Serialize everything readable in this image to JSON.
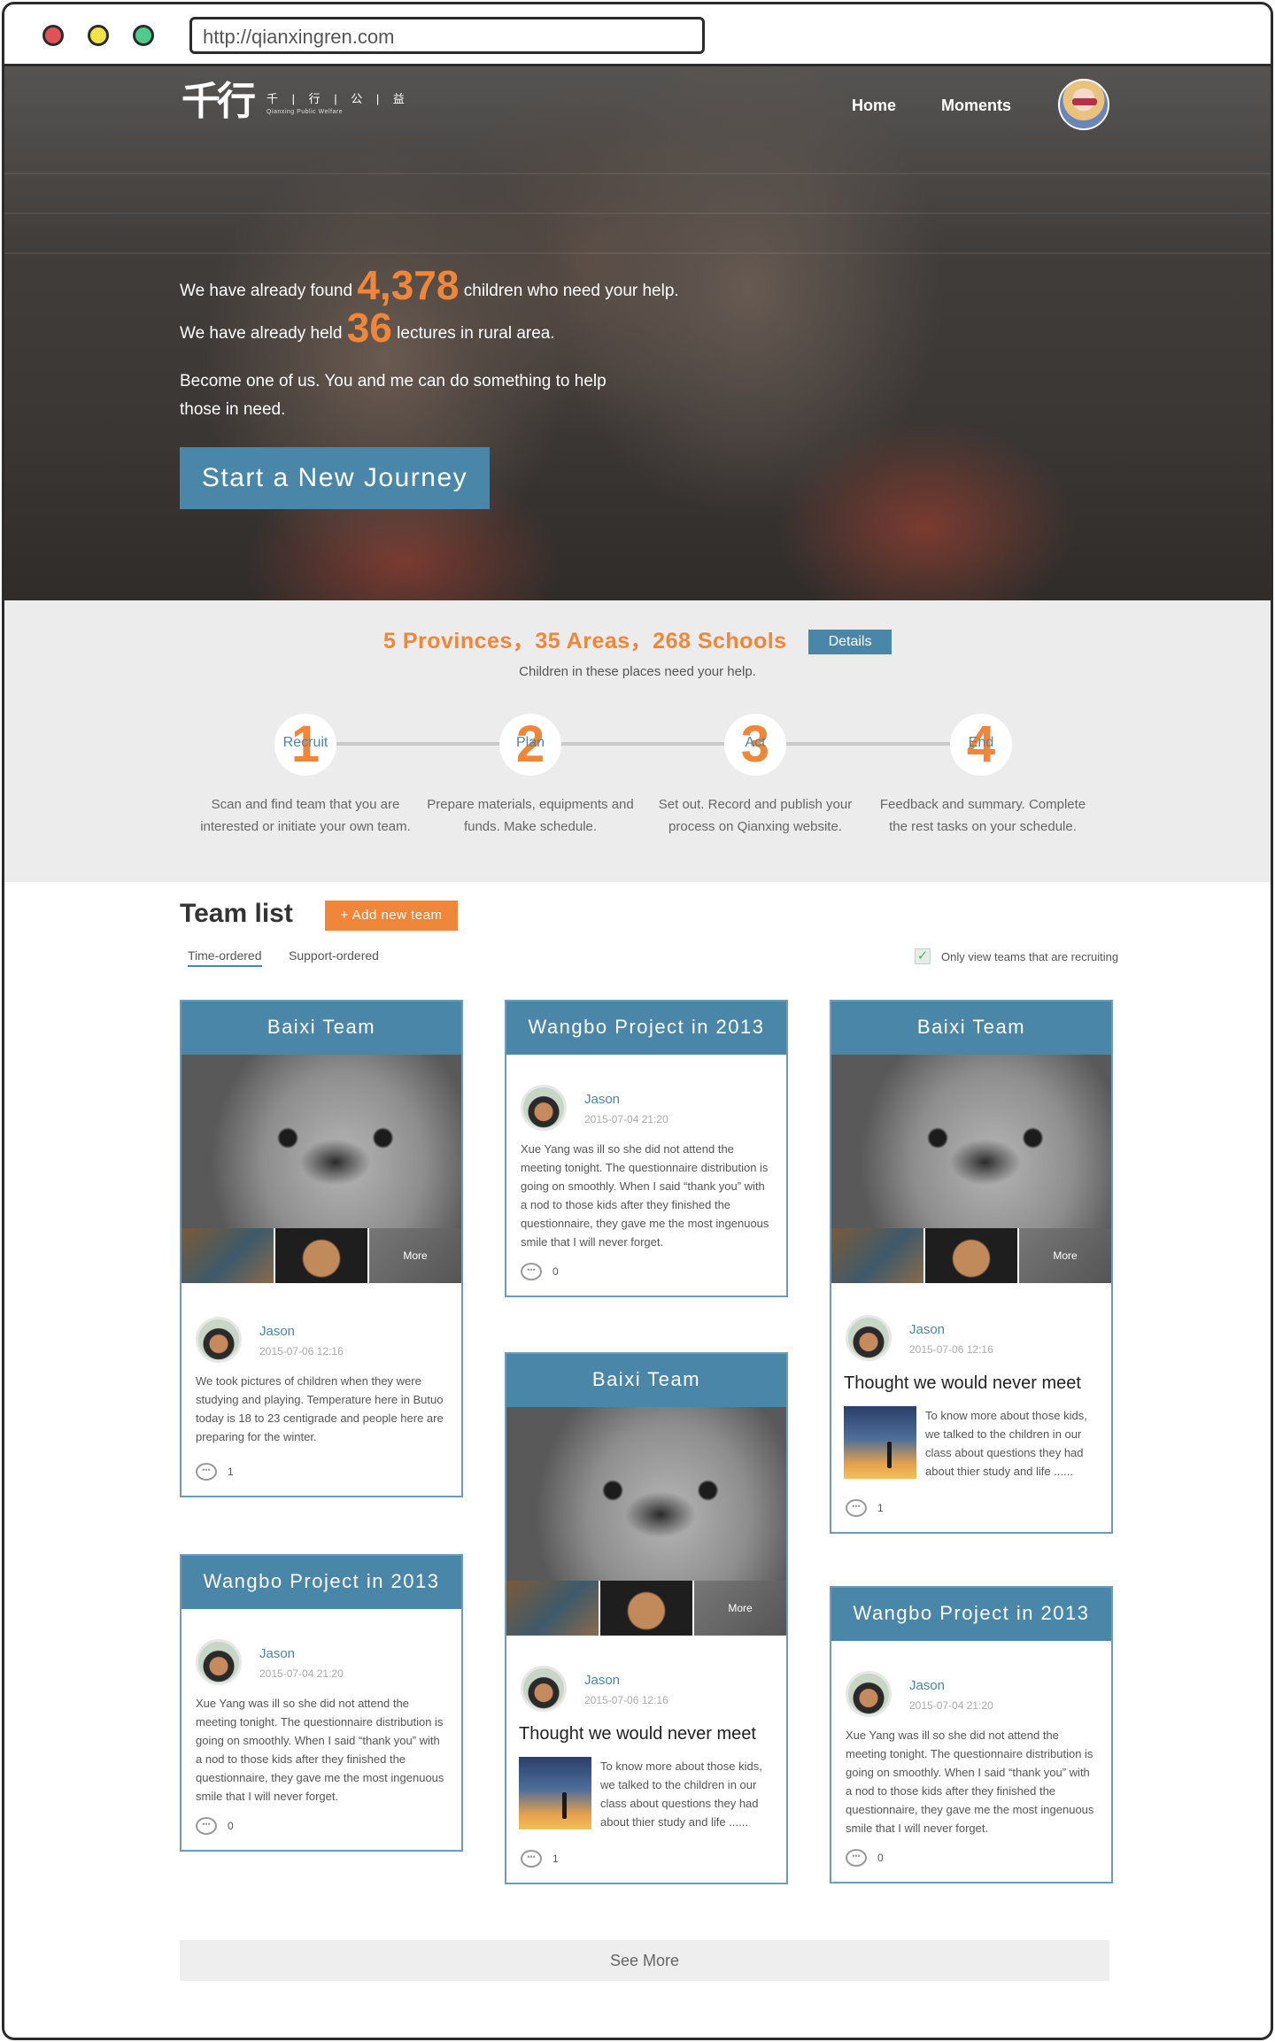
{
  "browser": {
    "url": "http://qianxingren.com"
  },
  "header": {
    "logo_mark": "千行",
    "logo_cn": "千 | 行 | 公 | 益",
    "logo_en": "Qianxing Public Welfare",
    "nav": {
      "home": "Home",
      "moments": "Moments"
    }
  },
  "hero": {
    "line1_pre": "We have already found",
    "children_count": "4,378",
    "line1_post": "children who need your help.",
    "line2_pre": "We have already held",
    "lectures_count": "36",
    "line2_post": "lectures in rural area.",
    "line3": "Become one of us. You and me can do something to help those in need.",
    "cta": "Start a New Journey"
  },
  "stats": {
    "headline": "5 Provinces，35 Areas，268 Schools",
    "details_button": "Details",
    "subtitle": "Children in these places need your help."
  },
  "steps": [
    {
      "num": "1",
      "label": "Recruit",
      "desc": "Scan and find team that you are interested or initiate your own team."
    },
    {
      "num": "2",
      "label": "Plan",
      "desc": "Prepare materials, equipments and funds. Make schedule."
    },
    {
      "num": "3",
      "label": "Act",
      "desc": "Set out. Record and publish your process on Qianxing website."
    },
    {
      "num": "4",
      "label": "End",
      "desc": "Feedback and summary. Complete the rest tasks on your schedule."
    }
  ],
  "team_list": {
    "title": "Team list",
    "add_button": "+ Add new team",
    "tabs": [
      "Time-ordered",
      "Support-ordered"
    ],
    "filter_label": "Only view teams that are recruiting",
    "filter_checked": true,
    "see_more": "See More"
  },
  "cards": {
    "c1": {
      "title": "Baixi Team",
      "more": "More",
      "author": "Jason",
      "date": "2015-07-06 12:16",
      "text": "We took pictures of children when they were studying and playing. Temperature here in Butuo today is 18 to 23 centigrade and people here are preparing for the winter.",
      "comments": "1"
    },
    "c2": {
      "title": "Wangbo Project in 2013",
      "author": "Jason",
      "date": "2015-07-04 21:20",
      "text": "Xue Yang was ill so she did not attend the meeting tonight. The questionnaire distribution is going on smoothly. When I said “thank you” with a nod to those kids after they finished the questionnaire, they gave me the most ingenuous smile that I will never forget.",
      "comments": "0"
    },
    "c3": {
      "title": "Wangbo Project in 2013",
      "author": "Jason",
      "date": "2015-07-04 21:20",
      "text": "Xue Yang was ill so she did not attend the meeting tonight. The questionnaire distribution is going on smoothly. When I said “thank you” with a nod to those kids after they finished the questionnaire, they gave me the most ingenuous smile that I will never forget.",
      "comments": "0"
    },
    "c4": {
      "title": "Baixi Team",
      "more": "More",
      "author": "Jason",
      "date": "2015-07-06 12:16",
      "story_title": "Thought we would never meet",
      "story_text": "To know more about those kids, we talked to the children in our class about questions they had about thier study and life ......",
      "comments": "1"
    },
    "c5": {
      "title": "Baixi Team",
      "more": "More",
      "author": "Jason",
      "date": "2015-07-06 12:16",
      "story_title": "Thought we would never meet",
      "story_text": "To know more about those kids, we talked to the children in our class about questions they had about thier study and life ......",
      "comments": "1"
    },
    "c6": {
      "title": "Wangbo Project in 2013",
      "author": "Jason",
      "date": "2015-07-04 21:20",
      "text": "Xue Yang was ill so she did not attend the meeting tonight. The questionnaire distribution is going on smoothly. When I said “thank you” with a nod to those kids after they finished the questionnaire, they gave me the most ingenuous smile that I will never forget.",
      "comments": "0"
    }
  },
  "colors": {
    "accent_orange": "#f0863a",
    "accent_blue": "#4a86a8"
  }
}
